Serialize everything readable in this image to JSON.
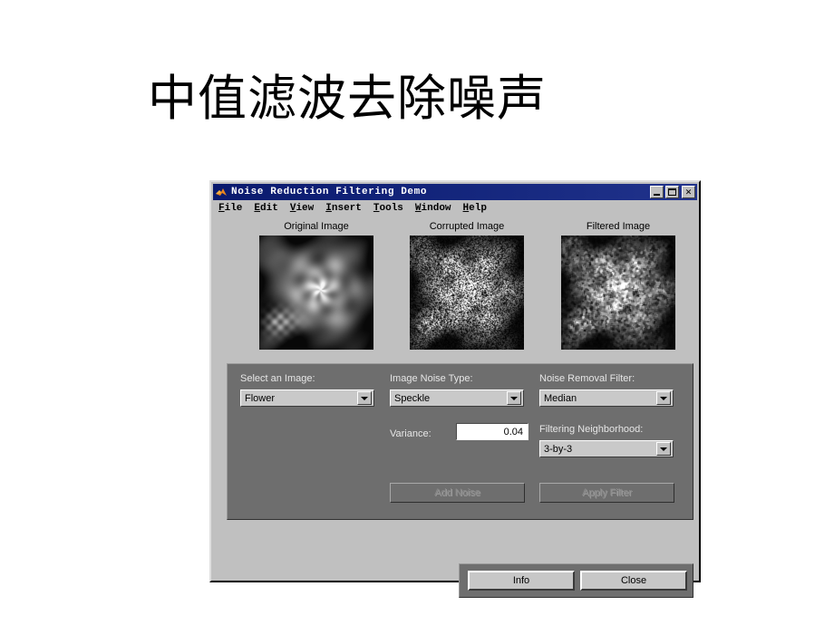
{
  "slide": {
    "title": "中值滤波去除噪声"
  },
  "window": {
    "title": "Noise Reduction Filtering Demo",
    "icon": "matlab-icon",
    "controls": {
      "minimize": "minimize-button",
      "maximize": "maximize-button",
      "close_glyph": "✕"
    }
  },
  "menu": {
    "items": [
      {
        "accel": "F",
        "rest": "ile"
      },
      {
        "accel": "E",
        "rest": "dit"
      },
      {
        "accel": "V",
        "rest": "iew"
      },
      {
        "accel": "I",
        "rest": "nsert"
      },
      {
        "accel": "T",
        "rest": "ools"
      },
      {
        "accel": "W",
        "rest": "indow"
      },
      {
        "accel": "H",
        "rest": "elp"
      }
    ]
  },
  "images": [
    {
      "caption": "Original Image",
      "kind": "clean"
    },
    {
      "caption": "Corrupted Image",
      "kind": "noisy"
    },
    {
      "caption": "Filtered Image",
      "kind": "filtered"
    }
  ],
  "panel": {
    "select_image": {
      "label": "Select an Image:",
      "value": "Flower"
    },
    "noise_type": {
      "label": "Image Noise Type:",
      "value": "Speckle"
    },
    "removal_filter": {
      "label": "Noise Removal Filter:",
      "value": "Median"
    },
    "variance": {
      "label": "Variance:",
      "value": "0.04"
    },
    "neighborhood": {
      "label": "Filtering Neighborhood:",
      "value": "3-by-3"
    },
    "add_noise_button": "Add Noise",
    "apply_filter_button": "Apply Filter"
  },
  "footer": {
    "info_button": "Info",
    "close_button": "Close"
  },
  "colors": {
    "slide_background": "#ffffff",
    "window_face": "#c0c0c0",
    "titlebar_start": "#0a1a6e",
    "titlebar_end": "#21338c",
    "panel_face": "#6e6e6e",
    "panel_label_text": "#e6e6e6",
    "disabled_text": "#8a8a8a",
    "field_background": "#ffffff"
  }
}
